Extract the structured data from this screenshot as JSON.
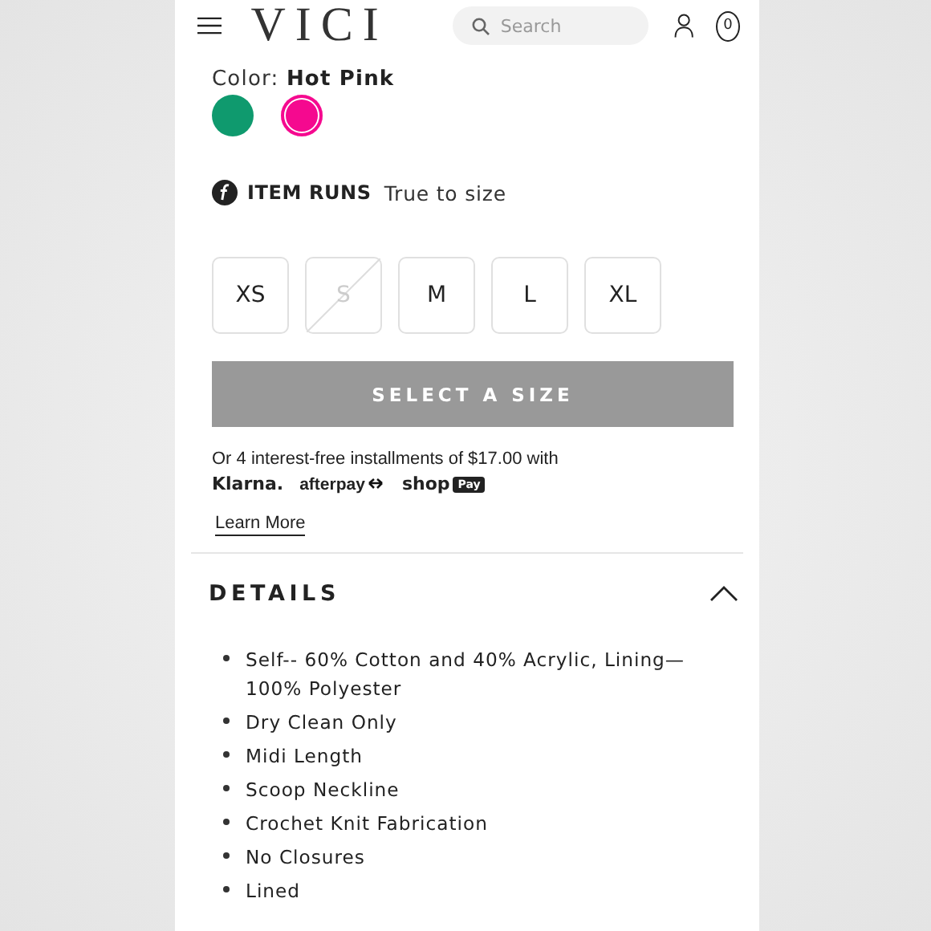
{
  "header": {
    "logo": "VICI",
    "search": {
      "placeholder": "Search"
    },
    "cart_count": "0"
  },
  "color": {
    "label": "Color:",
    "value": "Hot Pink",
    "swatches": [
      {
        "color": "#0f9a6e",
        "selected": false
      },
      {
        "color": "#f5098f",
        "selected": true
      }
    ]
  },
  "fit": {
    "label": "ITEM RUNS",
    "value": "True to size"
  },
  "sizes": [
    {
      "label": "XS",
      "available": true
    },
    {
      "label": "S",
      "available": false
    },
    {
      "label": "M",
      "available": true
    },
    {
      "label": "L",
      "available": true
    },
    {
      "label": "XL",
      "available": true
    }
  ],
  "add_button": {
    "label": "SELECT A SIZE",
    "disabled": true
  },
  "installments": {
    "text": "Or 4 interest-free installments of $17.00 with",
    "providers": [
      {
        "kind": "klarna",
        "label": "Klarna."
      },
      {
        "kind": "afterpay",
        "label": "afterpay"
      },
      {
        "kind": "shoppay",
        "label": "shop",
        "badge": "Pay"
      }
    ],
    "link": "Learn More"
  },
  "details": {
    "title": "DETAILS",
    "expanded": true,
    "items": [
      "Self-- 60% Cotton and 40% Acrylic, Lining—100% Polyester",
      "Dry Clean Only",
      "Midi Length",
      "Scoop Neckline",
      "Crochet Knit Fabrication",
      "No Closures",
      "Lined"
    ]
  }
}
